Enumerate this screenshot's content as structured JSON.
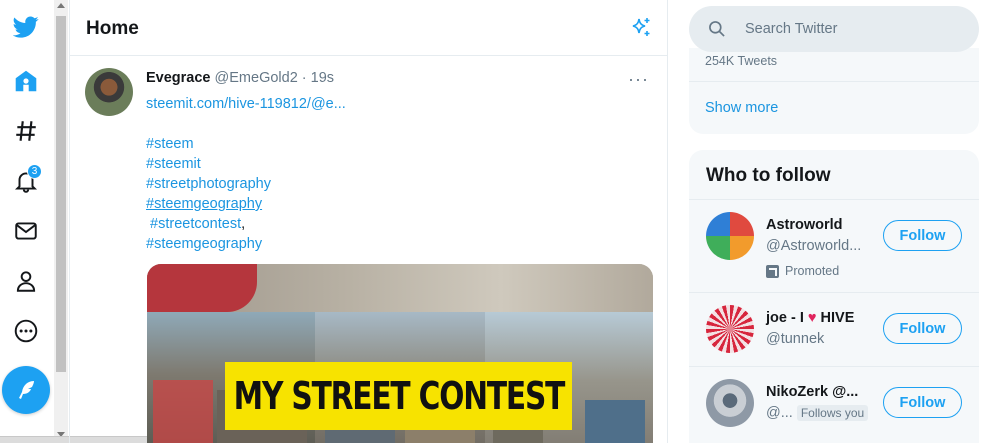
{
  "nav": {
    "notification_count": "3"
  },
  "main": {
    "title": "Home"
  },
  "tweet": {
    "author_name": "Evegrace",
    "author_handle": "@EmeGold2",
    "time": " · 19s",
    "link": "steemit.com/hive-119812/@e...",
    "tags": [
      "#steem",
      "#steemit",
      "#streetphotography",
      "#steemgeography",
      "#streetcontest",
      ",",
      "#steemgeography"
    ],
    "media_banner": "MY STREET CONTEST"
  },
  "right": {
    "search_placeholder": "Search Twitter",
    "trend_count": "254K Tweets",
    "show_more": "Show more",
    "who_to_follow": "Who to follow",
    "users": [
      {
        "name": "Astroworld",
        "handle": "@Astroworld...",
        "promoted": "Promoted",
        "follow": "Follow"
      },
      {
        "name_prefix": "joe - I ",
        "name_suffix": " HIVE",
        "heart": "♥",
        "handle": "@tunnek",
        "follow": "Follow"
      },
      {
        "name": "NikoZerk @...",
        "handle": "@...",
        "follows_you": "Follows you",
        "follow": "Follow"
      }
    ]
  },
  "colors": {
    "brand": "#1da1f2",
    "link": "#1b95e0",
    "banner": "#f7e300"
  }
}
